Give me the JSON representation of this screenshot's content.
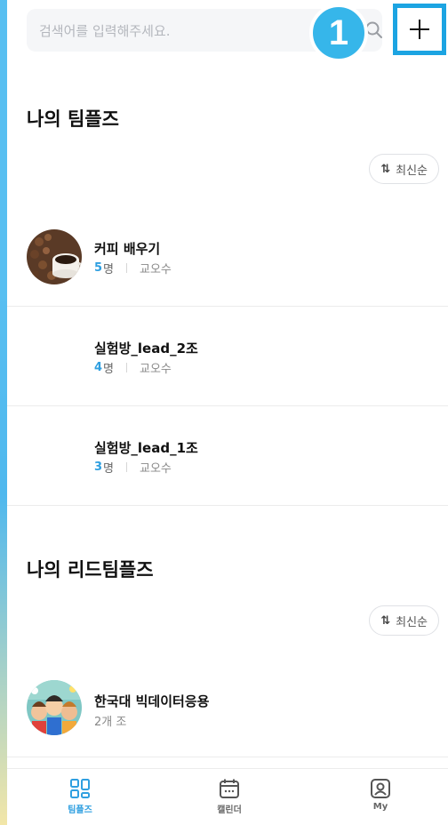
{
  "search": {
    "placeholder": "검색어를 입력해주세요."
  },
  "header": {
    "step_badge": "1"
  },
  "my_teams": {
    "title": "나의 팀플즈",
    "sort_label": "최신순",
    "items": [
      {
        "name": "커피 배우기",
        "count": "5",
        "count_unit": "명",
        "owner": "교오수"
      },
      {
        "name": "실험방_lead_2조",
        "count": "4",
        "count_unit": "명",
        "owner": "교오수"
      },
      {
        "name": "실험방_lead_1조",
        "count": "3",
        "count_unit": "명",
        "owner": "교오수"
      }
    ]
  },
  "lead_teams": {
    "title": "나의 리드팀플즈",
    "sort_label": "최신순",
    "items": [
      {
        "name": "한국대 빅데이터응용",
        "meta": "2개 조"
      }
    ]
  },
  "tabbar": {
    "tabs": [
      {
        "label": "팀플즈",
        "active": true
      },
      {
        "label": "캘린더",
        "active": false
      },
      {
        "label": "My",
        "active": false
      }
    ]
  },
  "colors": {
    "accent": "#2f9fe0",
    "highlight_border": "#1ca4e2",
    "badge": "#36b6ea"
  }
}
